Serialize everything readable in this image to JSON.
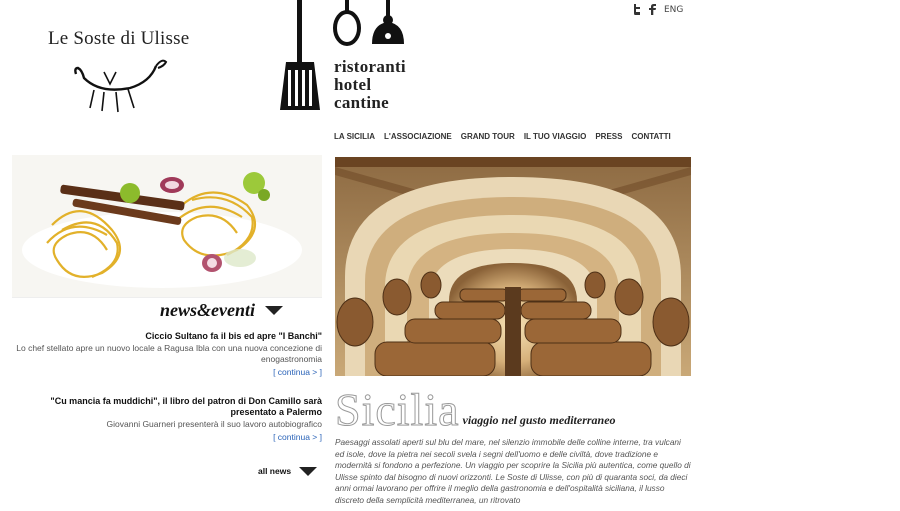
{
  "brand": {
    "title": "Le Soste di Ulisse",
    "tagline": [
      "ristoranti",
      "hotel",
      "cantine"
    ]
  },
  "social": {
    "twitter_icon": "twitter-icon",
    "facebook_icon": "facebook-icon",
    "language": "ENG"
  },
  "nav": {
    "items": [
      "LA SICILIA",
      "L'ASSOCIAZIONE",
      "GRAND TOUR",
      "IL TUO VIAGGIO",
      "PRESS",
      "CONTATTI"
    ]
  },
  "news": {
    "heading": "news&eventi",
    "items": [
      {
        "title": "Ciccio Sultano fa il bis ed apre \"I Banchi\"",
        "desc": "Lo chef stellato apre un nuovo locale a Ragusa Ibla con una nuova concezione di enogastronomia",
        "more": "[ continua > ]"
      },
      {
        "title": "\"Cu mancia fa muddichi\", il libro del patron di Don Camillo sarà presentato a Palermo",
        "desc": "Giovanni Guarneri presenterà il suo lavoro autobiografico",
        "more": "[ continua > ]"
      }
    ],
    "all_news": "all news"
  },
  "intro": {
    "title": "Sicilia",
    "subtitle": "viaggio nel gusto mediterraneo",
    "text": "Paesaggi assolati aperti sul blu del mare, nel silenzio immobile delle colline interne, tra vulcani ed isole, dove la pietra nei secoli svela i segni dell'uomo e delle civiltà, dove tradizione e modernità si fondono a perfezione. Un viaggio per scoprire la Sicilia più autentica, come quello di Ulisse spinto dal bisogno di nuovi orizzonti. Le Soste di Ulisse, con più di quaranta soci, da dieci anni ormai lavorano per offrire il meglio della gastronomia e dell'ospitalità siciliana, il lusso discreto della semplicità mediterranea, un ritrovato"
  },
  "colors": {
    "link": "#2a63b8",
    "text": "#222222",
    "muted": "#555555"
  }
}
